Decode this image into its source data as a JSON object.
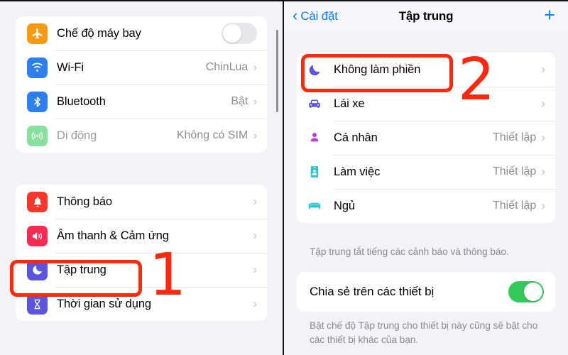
{
  "left_panel": {
    "scrollbar": {
      "name": "vertical-scrollbar"
    },
    "connectivity_card": {
      "rows": [
        {
          "icon": "airplane-icon",
          "label": "Chế độ máy bay",
          "value": "",
          "control": "toggle",
          "toggle_on": false,
          "dim": false
        },
        {
          "icon": "wifi-icon",
          "label": "Wi-Fi",
          "value": "ChinLua",
          "control": "chevron",
          "dim": false
        },
        {
          "icon": "bluetooth-icon",
          "label": "Bluetooth",
          "value": "Bật",
          "control": "chevron",
          "dim": false
        },
        {
          "icon": "cellular-icon",
          "label": "Di động",
          "value": "Không có SIM",
          "control": "chevron",
          "dim": true
        }
      ]
    },
    "system_card": {
      "rows": [
        {
          "icon": "bell-icon",
          "label": "Thông báo",
          "value": "",
          "control": "chevron",
          "dim": false
        },
        {
          "icon": "speaker-icon",
          "label": "Âm thanh & Cảm ứng",
          "value": "",
          "control": "chevron",
          "dim": false
        },
        {
          "icon": "moon-icon",
          "label": "Tập trung",
          "value": "",
          "control": "chevron",
          "dim": false
        },
        {
          "icon": "hourglass-icon",
          "label": "Thời gian sử dụng",
          "value": "",
          "control": "chevron",
          "dim": false
        }
      ]
    }
  },
  "right_panel": {
    "nav": {
      "back_label": "Cài đặt",
      "back_icon": "chevron-left-icon",
      "title": "Tập trung",
      "add_icon": "plus-icon"
    },
    "focus_modes_card": {
      "rows": [
        {
          "icon": "moon-icon",
          "label": "Không làm phiền",
          "value": "",
          "control": "chevron"
        },
        {
          "icon": "car-icon",
          "label": "Lái xe",
          "value": "",
          "control": "chevron"
        },
        {
          "icon": "person-icon",
          "label": "Cá nhân",
          "value": "Thiết lập",
          "control": "chevron"
        },
        {
          "icon": "badge-icon",
          "label": "Làm việc",
          "value": "Thiết lập",
          "control": "chevron"
        },
        {
          "icon": "bed-icon",
          "label": "Ngủ",
          "value": "Thiết lập",
          "control": "chevron"
        }
      ]
    },
    "focus_footnote": "Tập trung tắt tiếng các cảnh báo và thông báo.",
    "share_card": {
      "label": "Chia sẻ trên các thiết bị",
      "toggle_on": true
    },
    "share_footnote": "Bật chế độ Tập trung cho thiết bị này cũng sẽ bật cho các thiết bị khác của bạn."
  },
  "annotations": {
    "color": "#fa2a11",
    "step_1": "1",
    "step_2": "2"
  }
}
